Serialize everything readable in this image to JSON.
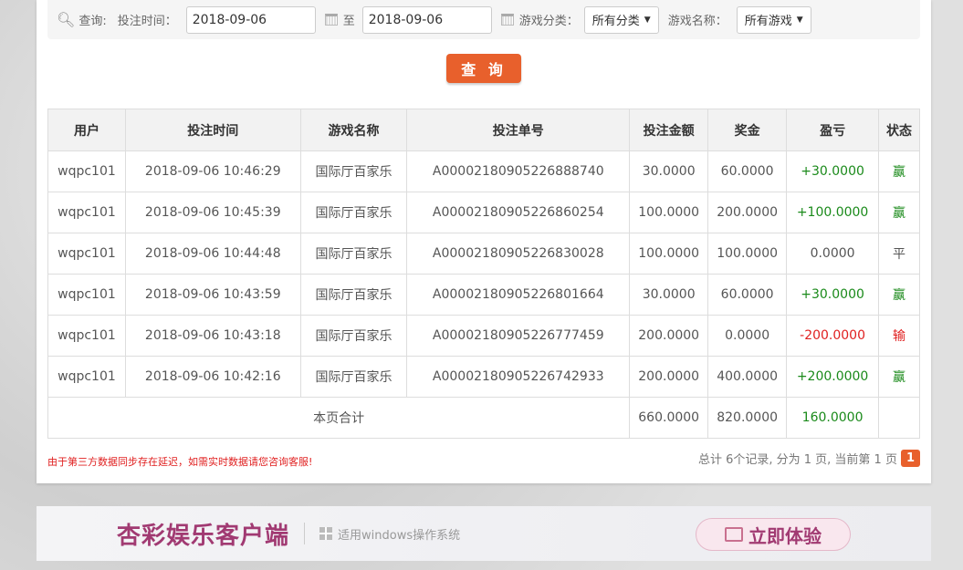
{
  "filter": {
    "query_label": "查询:",
    "time_label": "投注时间：",
    "start": "2018-09-06",
    "to": "至",
    "end": "2018-09-06",
    "category_label": "游戏分类：",
    "category": "所有分类",
    "game_label": "游戏名称：",
    "game": "所有游戏"
  },
  "search_button": "查 询",
  "table": {
    "headers": [
      "用户",
      "投注时间",
      "游戏名称",
      "投注单号",
      "投注金额",
      "奖金",
      "盈亏",
      "状态"
    ],
    "rows": [
      [
        "wqpc101",
        "2018-09-06 10:46:29",
        "国际厅百家乐",
        "A00002180905226888740",
        "30.0000",
        "60.0000",
        "+30.0000",
        "赢"
      ],
      [
        "wqpc101",
        "2018-09-06 10:45:39",
        "国际厅百家乐",
        "A00002180905226860254",
        "100.0000",
        "200.0000",
        "+100.0000",
        "赢"
      ],
      [
        "wqpc101",
        "2018-09-06 10:44:48",
        "国际厅百家乐",
        "A00002180905226830028",
        "100.0000",
        "100.0000",
        "0.0000",
        "平"
      ],
      [
        "wqpc101",
        "2018-09-06 10:43:59",
        "国际厅百家乐",
        "A00002180905226801664",
        "30.0000",
        "60.0000",
        "+30.0000",
        "赢"
      ],
      [
        "wqpc101",
        "2018-09-06 10:43:18",
        "国际厅百家乐",
        "A00002180905226777459",
        "200.0000",
        "0.0000",
        "-200.0000",
        "输"
      ],
      [
        "wqpc101",
        "2018-09-06 10:42:16",
        "国际厅百家乐",
        "A00002180905226742933",
        "200.0000",
        "400.0000",
        "+200.0000",
        "赢"
      ]
    ],
    "total": {
      "label": "本页合计",
      "amount": "660.0000",
      "bonus": "820.0000",
      "profit": "160.0000"
    }
  },
  "note": "由于第三方数据同步存在延迟，如需实时数据请您咨询客服!",
  "pagination": {
    "summary": "总计 6个记录, 分为 1 页, 当前第 1 页",
    "current": "1"
  },
  "banner": {
    "brand": "杏彩娱乐客户端",
    "os": "适用windows操作系统",
    "cta": "立即体验"
  }
}
